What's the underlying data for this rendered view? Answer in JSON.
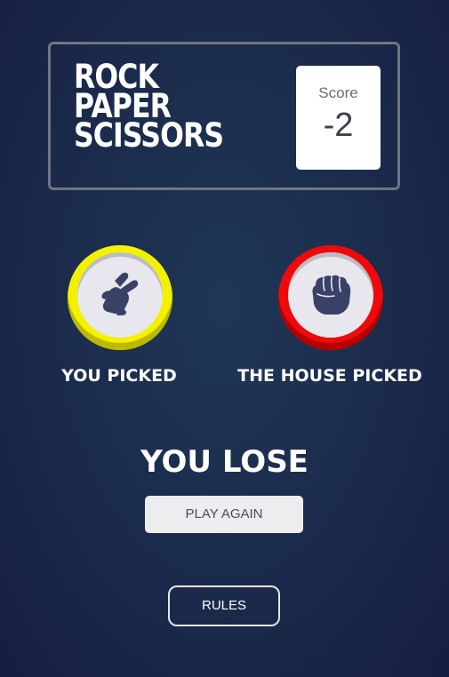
{
  "header": {
    "title_lines": [
      "ROCK",
      "PAPER",
      "SCISSORS"
    ],
    "score_label": "Score",
    "score_value": "-2"
  },
  "player": {
    "label": "YOU PICKED",
    "choice": "scissors",
    "icon": "scissors-hand-icon",
    "ring_color": "#f2f200"
  },
  "house": {
    "label": "THE HOUSE PICKED",
    "choice": "rock",
    "icon": "rock-fist-icon",
    "ring_color": "#ee0a0a"
  },
  "result": {
    "text": "YOU LOSE",
    "play_again_label": "PLAY AGAIN"
  },
  "footer": {
    "rules_label": "RULES"
  },
  "colors": {
    "background": "#1b2a4b",
    "icon": "#3a4166"
  }
}
